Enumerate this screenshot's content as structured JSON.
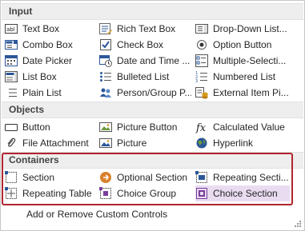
{
  "sections": {
    "input": "Input",
    "objects": "Objects",
    "containers": "Containers"
  },
  "input_items": [
    {
      "label": "Text Box",
      "icon": "text-box-icon"
    },
    {
      "label": "Rich Text Box",
      "icon": "rich-text-box-icon"
    },
    {
      "label": "Drop-Down List...",
      "icon": "drop-down-list-icon"
    },
    {
      "label": "Combo Box",
      "icon": "combo-box-icon"
    },
    {
      "label": "Check Box",
      "icon": "check-box-icon"
    },
    {
      "label": "Option Button",
      "icon": "option-button-icon"
    },
    {
      "label": "Date Picker",
      "icon": "date-picker-icon"
    },
    {
      "label": "Date and Time ...",
      "icon": "date-time-picker-icon"
    },
    {
      "label": "Multiple-Selecti...",
      "icon": "multiple-selection-list-icon"
    },
    {
      "label": "List Box",
      "icon": "list-box-icon"
    },
    {
      "label": "Bulleted List",
      "icon": "bulleted-list-icon"
    },
    {
      "label": "Numbered List",
      "icon": "numbered-list-icon"
    },
    {
      "label": "Plain List",
      "icon": "plain-list-icon"
    },
    {
      "label": "Person/Group P...",
      "icon": "person-group-picker-icon"
    },
    {
      "label": "External Item Pi...",
      "icon": "external-item-picker-icon"
    }
  ],
  "object_items": [
    {
      "label": "Button",
      "icon": "button-icon"
    },
    {
      "label": "Picture Button",
      "icon": "picture-button-icon"
    },
    {
      "label": "Calculated Value",
      "icon": "calculated-value-icon"
    },
    {
      "label": "File Attachment",
      "icon": "file-attachment-icon"
    },
    {
      "label": "Picture",
      "icon": "picture-icon"
    },
    {
      "label": "Hyperlink",
      "icon": "hyperlink-icon"
    }
  ],
  "container_items": [
    {
      "label": "Section",
      "icon": "section-icon"
    },
    {
      "label": "Optional Section",
      "icon": "optional-section-icon"
    },
    {
      "label": "Repeating Secti...",
      "icon": "repeating-section-icon"
    },
    {
      "label": "Repeating Table",
      "icon": "repeating-table-icon"
    },
    {
      "label": "Choice Group",
      "icon": "choice-group-icon"
    },
    {
      "label": "Choice Section",
      "icon": "choice-section-icon",
      "selected": true
    }
  ],
  "footer": {
    "label": "Add or Remove Custom Controls"
  },
  "colors": {
    "highlight_border": "#b0252f",
    "selected_bg": "#e9dcf1",
    "header_bg": "#eeeeee"
  }
}
